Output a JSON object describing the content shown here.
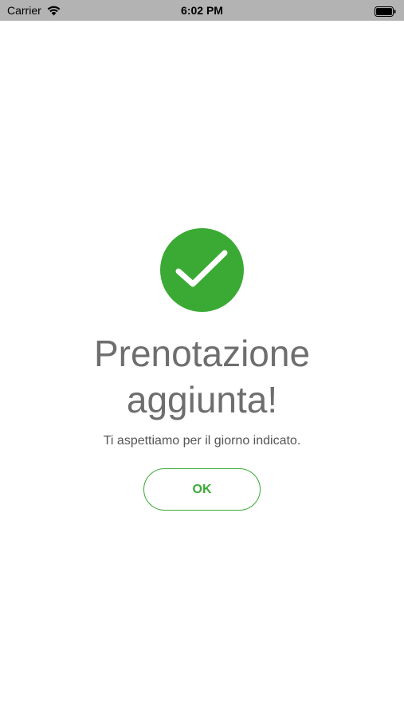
{
  "status_bar": {
    "carrier": "Carrier",
    "time": "6:02 PM",
    "wifi_icon": "wifi-icon",
    "battery_icon": "battery-icon",
    "background": "#b3b3b3"
  },
  "confirmation": {
    "icon": "checkmark-circle-icon",
    "title_line1": "Prenotazione",
    "title_line2": "aggiunta!",
    "message": "Ti aspettiamo per il giorno indicato.",
    "ok_label": "OK"
  },
  "colors": {
    "accent": "#3aaa35",
    "title_text": "#6e6e6e",
    "body_text": "#555555",
    "background": "#ffffff"
  }
}
